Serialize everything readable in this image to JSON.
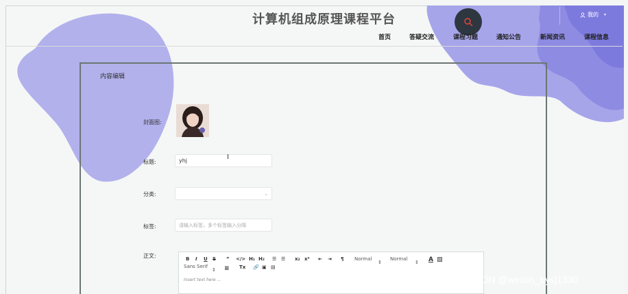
{
  "header": {
    "site_title": "计算机组成原理课程平台",
    "user_label": "我的",
    "nav": [
      "首页",
      "答疑交流",
      "课程习题",
      "通知公告",
      "新闻资讯",
      "课程信息"
    ]
  },
  "card": {
    "title": "内容编辑"
  },
  "form": {
    "cover_label": "封面图:",
    "title_label": "标题:",
    "title_value": "yhj",
    "category_label": "分类:",
    "category_value": "",
    "tags_label": "标签:",
    "tags_placeholder": "请输入标签，多个标签输入分隔",
    "body_label": "正文:"
  },
  "editor": {
    "font_size_1": "Normal",
    "font_size_2": "Normal",
    "font_family": "Sans Serif",
    "placeholder": "Insert text here ..."
  },
  "watermark": "CSDN @weixin_bysj1330",
  "colors": {
    "blob": "#a9a8ea",
    "blob_dark": "#8f8de4",
    "search_button": "#2e3640",
    "accent": "#e8463d"
  }
}
